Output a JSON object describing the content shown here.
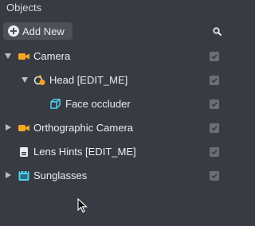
{
  "panel": {
    "title": "Objects"
  },
  "toolbar": {
    "add_label": "Add New",
    "search_icon": "search-icon"
  },
  "tree": [
    {
      "label": "Camera",
      "icon": "camera-icon",
      "expanded": true,
      "checked": true
    },
    {
      "label": "Head [EDIT_ME]",
      "icon": "head-binding-icon",
      "expanded": true,
      "checked": true
    },
    {
      "label": "Face occluder",
      "icon": "cube-icon",
      "checked": true
    },
    {
      "label": "Orthographic Camera",
      "icon": "camera-icon",
      "expanded": false,
      "checked": true
    },
    {
      "label": "Lens Hints [EDIT_ME]",
      "icon": "document-icon",
      "checked": true
    },
    {
      "label": "Sunglasses",
      "icon": "film-frame-icon",
      "expanded": false,
      "checked": true
    }
  ],
  "colors": {
    "background": "#383c42",
    "camera_orange": "#f5a623",
    "cube_cyan": "#4fd0ee",
    "checkbox": "#6a6f76"
  }
}
